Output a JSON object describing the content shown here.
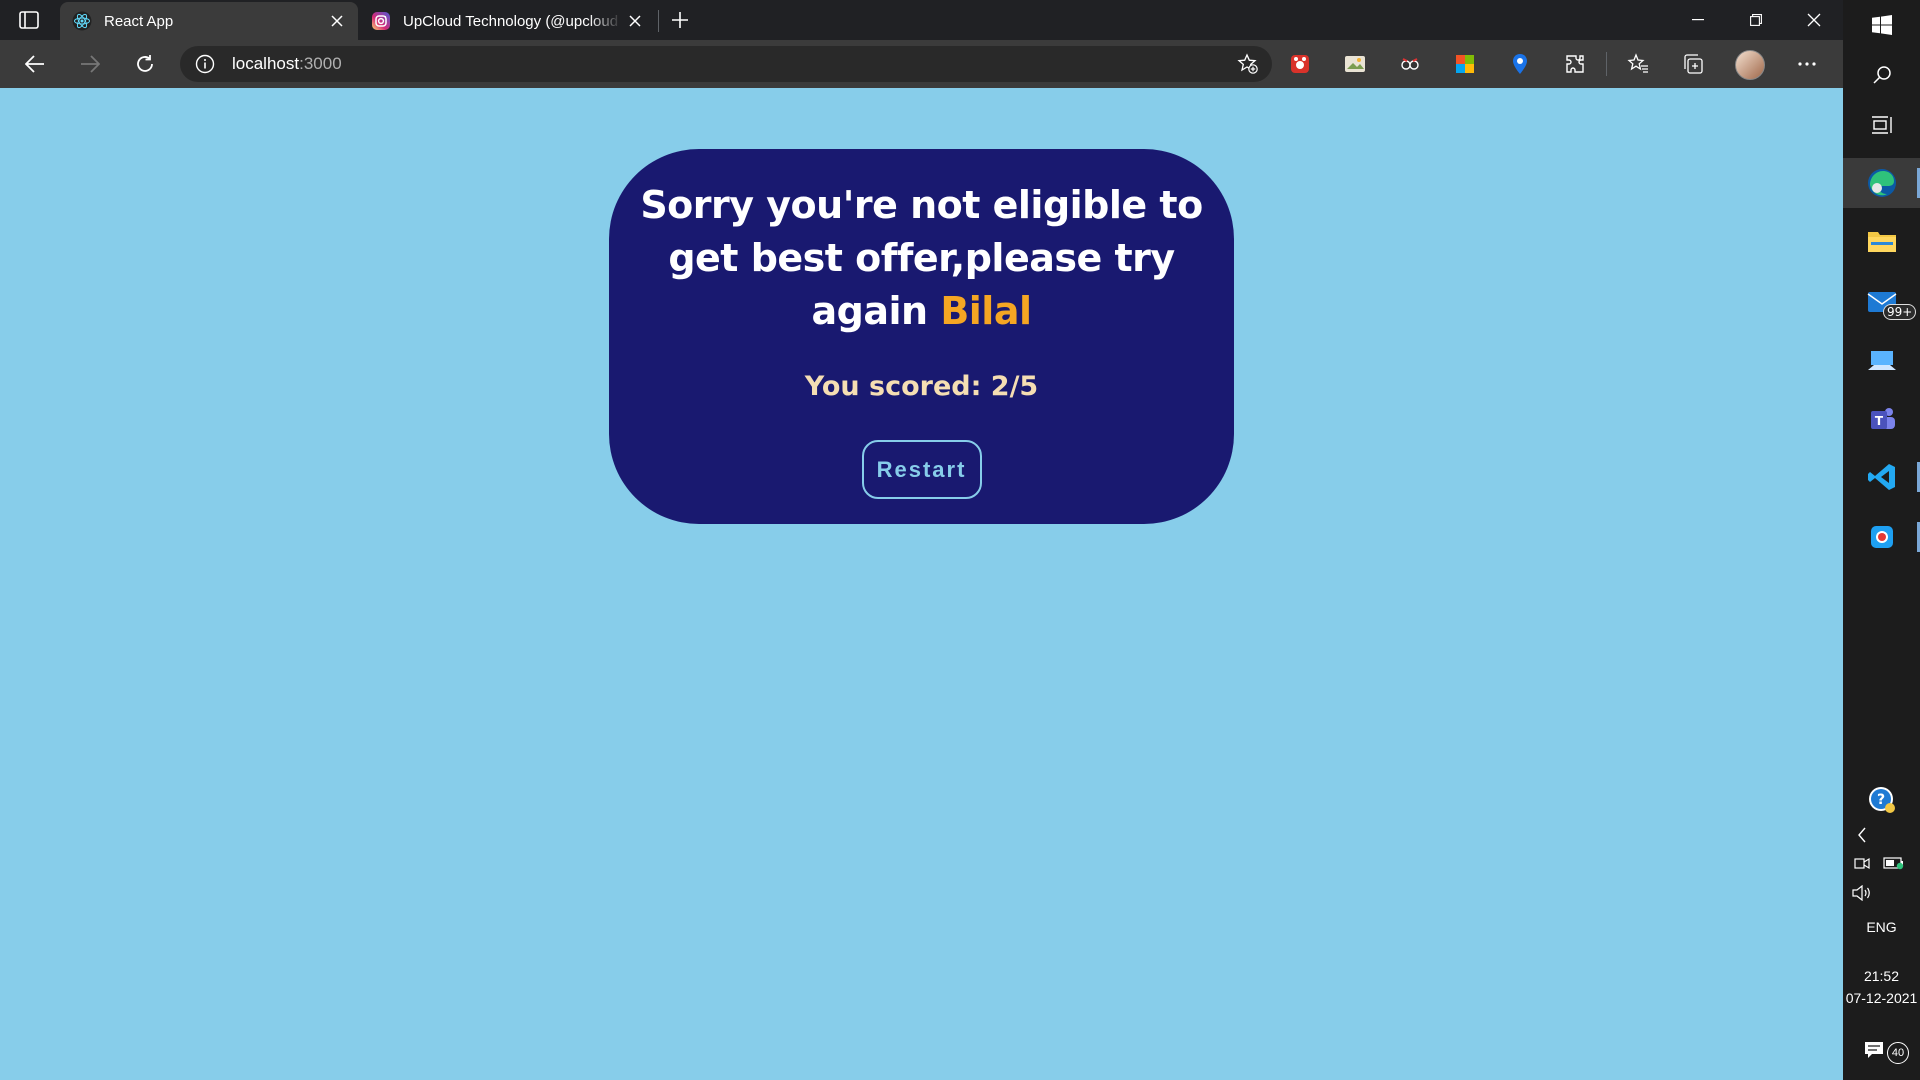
{
  "browser": {
    "tabs": [
      {
        "title": "React App",
        "icon": "react-icon",
        "active": true
      },
      {
        "title": "UpCloud Technology (@upcloud",
        "icon": "instagram-icon",
        "active": false
      }
    ],
    "address": {
      "host": "localhost",
      "port": ":3000"
    }
  },
  "quiz": {
    "message": "Sorry you're not eligible to get best offer,please try again",
    "name": "Bilal",
    "score_text": "You scored: 2/5",
    "restart_label": "Restart"
  },
  "taskbar": {
    "mail_badge": "99+",
    "language": "ENG",
    "time": "21:52",
    "date": "07-12-2021",
    "notification_count": "40"
  },
  "colors": {
    "page_background": "#87cdea",
    "card_background": "#191970",
    "name_accent": "#f5a623",
    "score_text": "#f5deb3"
  }
}
